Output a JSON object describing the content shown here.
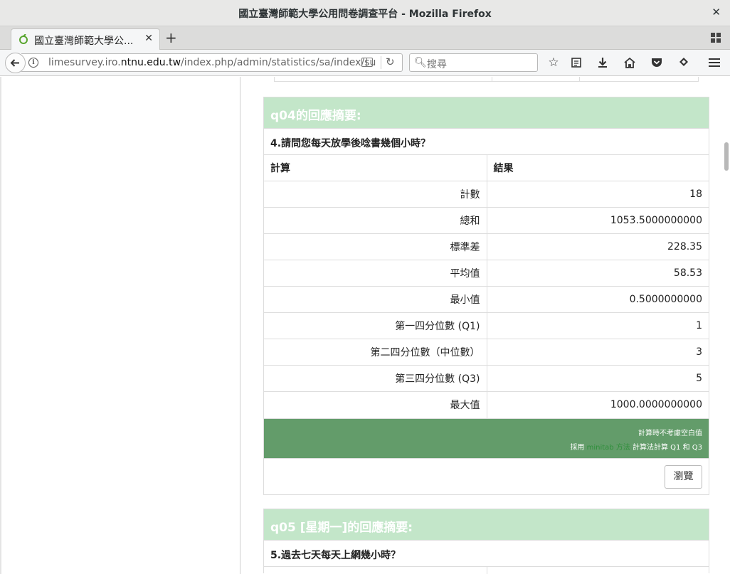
{
  "window": {
    "title": "國立臺灣師範大學公用問卷調查平台 - Mozilla Firefox",
    "close_glyph": "✕"
  },
  "tab": {
    "label": "國立臺灣師範大學公...",
    "close_glyph": "✕"
  },
  "newtab_glyph": "+",
  "url": {
    "prefix": "limesurvey.iro.",
    "domain": "ntnu.edu.tw",
    "path": "/index.php/admin/statistics/sa/index/su"
  },
  "search": {
    "placeholder": "搜尋"
  },
  "toolbar_icons": [
    "star-icon",
    "library-icon",
    "download-icon",
    "home-icon",
    "pocket-icon",
    "sync-icon",
    "menu-icon"
  ],
  "panel1": {
    "header": "q04的回應摘要:",
    "question": "4.請問您每天放學後唸書幾個小時？",
    "col_calc": "計算",
    "col_result": "結果",
    "rows": [
      {
        "label": "計數",
        "value": "18"
      },
      {
        "label": "總和",
        "value": "1053.5000000000"
      },
      {
        "label": "標準差",
        "value": "228.35"
      },
      {
        "label": "平均值",
        "value": "58.53"
      },
      {
        "label": "最小值",
        "value": "0.5000000000"
      },
      {
        "label": "第一四分位數 (Q1)",
        "value": "1"
      },
      {
        "label": "第二四分位數（中位數）",
        "value": "3"
      },
      {
        "label": "第三四分位數 (Q3)",
        "value": "5"
      },
      {
        "label": "最大值",
        "value": "1000.0000000000"
      }
    ],
    "note1": "計算時不考慮空白值",
    "note2_pre": "採用 ",
    "note2_link": "minitab 方法",
    "note2_post": " 計算法計算 Q1 和 Q3",
    "browse": "瀏覽"
  },
  "panel2": {
    "header": "q05 [星期一]的回應摘要:",
    "question": "5.過去七天每天上網幾小時？"
  },
  "colors": {
    "panel_header": "#c3e6c9",
    "footnote_bg": "#639c6a",
    "link": "#2f8f3b"
  }
}
